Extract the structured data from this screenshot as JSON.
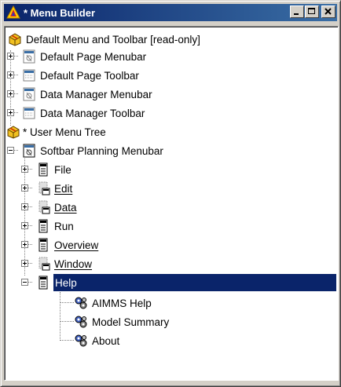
{
  "window": {
    "title": "* Menu Builder"
  },
  "tree": {
    "default_root": "Default Menu and Toolbar [read-only]",
    "default_items": [
      {
        "label": "Default Page Menubar",
        "icon": "menubar-icon"
      },
      {
        "label": "Default Page Toolbar",
        "icon": "toolbar-icon"
      },
      {
        "label": "Data Manager Menubar",
        "icon": "menubar-icon"
      },
      {
        "label": "Data Manager Toolbar",
        "icon": "toolbar-icon"
      }
    ],
    "user_root": "* User Menu Tree",
    "softbar": "Softbar Planning Menubar",
    "menus": [
      {
        "label": "File"
      },
      {
        "label": "Edit"
      },
      {
        "label": "Data"
      },
      {
        "label": "Run"
      },
      {
        "label": "Overview"
      },
      {
        "label": "Window"
      },
      {
        "label": "Help",
        "selected": true
      }
    ],
    "help_items": [
      {
        "label": "AIMMS Help"
      },
      {
        "label": "Model Summary"
      },
      {
        "label": "About"
      }
    ]
  },
  "colors": {
    "title_bar": "#0a246a",
    "selection": "#0a246a",
    "face": "#d4d0c8"
  }
}
